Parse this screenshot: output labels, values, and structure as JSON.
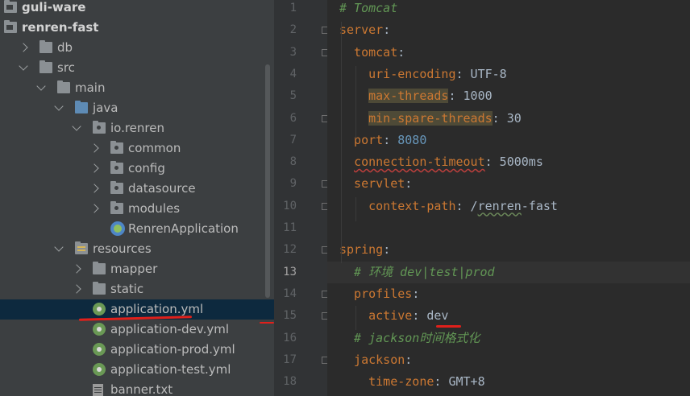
{
  "tree": {
    "items": [
      {
        "label": "guli-ware",
        "icon": "module-folder-icon",
        "depth": 0,
        "arrow": "none",
        "bold": true
      },
      {
        "label": "renren-fast",
        "icon": "module-folder-icon",
        "depth": 0,
        "arrow": "none",
        "bold": true
      },
      {
        "label": "db",
        "icon": "folder-icon",
        "depth": 1,
        "arrow": "right"
      },
      {
        "label": "src",
        "icon": "folder-icon",
        "depth": 1,
        "arrow": "down"
      },
      {
        "label": "main",
        "icon": "folder-icon",
        "depth": 2,
        "arrow": "down"
      },
      {
        "label": "java",
        "icon": "source-folder-icon",
        "depth": 3,
        "arrow": "down"
      },
      {
        "label": "io.renren",
        "icon": "package-icon",
        "depth": 4,
        "arrow": "down"
      },
      {
        "label": "common",
        "icon": "package-icon",
        "depth": 5,
        "arrow": "right"
      },
      {
        "label": "config",
        "icon": "package-icon",
        "depth": 5,
        "arrow": "right"
      },
      {
        "label": "datasource",
        "icon": "package-icon",
        "depth": 5,
        "arrow": "right"
      },
      {
        "label": "modules",
        "icon": "package-icon",
        "depth": 5,
        "arrow": "right"
      },
      {
        "label": "RenrenApplication",
        "icon": "spring-boot-app-icon",
        "depth": 5,
        "arrow": "none"
      },
      {
        "label": "resources",
        "icon": "resources-folder-icon",
        "depth": 3,
        "arrow": "down"
      },
      {
        "label": "mapper",
        "icon": "folder-icon",
        "depth": 4,
        "arrow": "right"
      },
      {
        "label": "static",
        "icon": "folder-icon",
        "depth": 4,
        "arrow": "right"
      },
      {
        "label": "application.yml",
        "icon": "spring-yml-icon",
        "depth": 4,
        "arrow": "none",
        "selected": true
      },
      {
        "label": "application-dev.yml",
        "icon": "spring-yml-icon",
        "depth": 4,
        "arrow": "none"
      },
      {
        "label": "application-prod.yml",
        "icon": "spring-yml-icon",
        "depth": 4,
        "arrow": "none"
      },
      {
        "label": "application-test.yml",
        "icon": "spring-yml-icon",
        "depth": 4,
        "arrow": "none"
      },
      {
        "label": "banner.txt",
        "icon": "text-file-icon",
        "depth": 4,
        "arrow": "none"
      }
    ]
  },
  "editor": {
    "current_line": 13,
    "lines": [
      {
        "n": "1",
        "parts": [
          {
            "t": "# Tomcat",
            "s": "c"
          }
        ]
      },
      {
        "n": "2",
        "parts": [
          {
            "t": "server",
            "s": "k"
          },
          {
            "t": ":",
            "s": "v"
          }
        ]
      },
      {
        "n": "3",
        "parts": [
          {
            "t": "  tomcat",
            "s": "k"
          },
          {
            "t": ":",
            "s": "v"
          }
        ]
      },
      {
        "n": "4",
        "parts": [
          {
            "t": "    uri-encoding",
            "s": "k"
          },
          {
            "t": ": UTF-8",
            "s": "v"
          }
        ]
      },
      {
        "n": "5",
        "parts": [
          {
            "t": "    ",
            "s": "v"
          },
          {
            "t": "max-threads",
            "s": "k hl"
          },
          {
            "t": ": 1000",
            "s": "v"
          }
        ]
      },
      {
        "n": "6",
        "parts": [
          {
            "t": "    ",
            "s": "v"
          },
          {
            "t": "min-spare-threads",
            "s": "k hl"
          },
          {
            "t": ": 30",
            "s": "v"
          }
        ]
      },
      {
        "n": "7",
        "parts": [
          {
            "t": "  port",
            "s": "k"
          },
          {
            "t": ": ",
            "s": "v"
          },
          {
            "t": "8080",
            "s": "n"
          }
        ]
      },
      {
        "n": "8",
        "parts": [
          {
            "t": "  ",
            "s": "v"
          },
          {
            "t": "connection-timeout",
            "s": "k wave"
          },
          {
            "t": ": 5000ms",
            "s": "v"
          }
        ]
      },
      {
        "n": "9",
        "parts": [
          {
            "t": "  servlet",
            "s": "k"
          },
          {
            "t": ":",
            "s": "v"
          }
        ]
      },
      {
        "n": "10",
        "parts": [
          {
            "t": "    context-path",
            "s": "k"
          },
          {
            "t": ": /",
            "s": "v"
          },
          {
            "t": "renren",
            "s": "v wave-g"
          },
          {
            "t": "-fast",
            "s": "v"
          }
        ]
      },
      {
        "n": "11",
        "parts": []
      },
      {
        "n": "12",
        "parts": [
          {
            "t": "spring",
            "s": "k"
          },
          {
            "t": ":",
            "s": "v"
          }
        ]
      },
      {
        "n": "13",
        "parts": [
          {
            "t": "  # 环境 dev|test|prod",
            "s": "c"
          }
        ]
      },
      {
        "n": "14",
        "parts": [
          {
            "t": "  profiles",
            "s": "k"
          },
          {
            "t": ":",
            "s": "v"
          }
        ]
      },
      {
        "n": "15",
        "parts": [
          {
            "t": "    active",
            "s": "k"
          },
          {
            "t": ": ",
            "s": "v"
          },
          {
            "t": "dev",
            "s": "v"
          }
        ]
      },
      {
        "n": "16",
        "parts": [
          {
            "t": "  # jackson时间格式化",
            "s": "c"
          }
        ]
      },
      {
        "n": "17",
        "parts": [
          {
            "t": "  jackson",
            "s": "k"
          },
          {
            "t": ":",
            "s": "v"
          }
        ]
      },
      {
        "n": "18",
        "parts": [
          {
            "t": "    time-zone",
            "s": "k"
          },
          {
            "t": ": GMT+8",
            "s": "v"
          }
        ]
      }
    ]
  },
  "colors": {
    "keyword": "#cc7832",
    "comment": "#629755",
    "number": "#6897bb",
    "annotation_red": "#e0201b",
    "selection": "#0d293e"
  }
}
